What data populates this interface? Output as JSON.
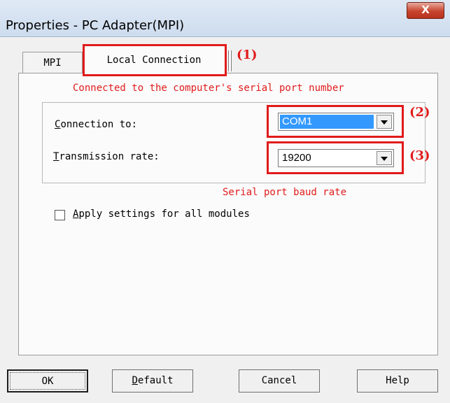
{
  "window": {
    "title": "Properties - PC Adapter(MPI)",
    "close_glyph": "X"
  },
  "tabs": [
    {
      "label": "MPI",
      "active": false
    },
    {
      "label": "Local Connection",
      "active": true
    }
  ],
  "annotations": {
    "tab_marker": "(1)",
    "port_marker": "(2)",
    "rate_marker": "(3)",
    "port_note": "Connected to the computer's serial port number",
    "rate_note": "Serial port baud rate",
    "highlight_color": "#e11b1b"
  },
  "connection": {
    "connection_to_label_key": "C",
    "connection_to_label_rest": "onnection to:",
    "connection_to_value": "COM1",
    "transmission_rate_label_key": "T",
    "transmission_rate_label_rest": "ransmission rate:",
    "transmission_rate_value": "19200"
  },
  "apply_all": {
    "label_key": "A",
    "label_rest": "pply settings for all modules",
    "checked": false
  },
  "buttons": {
    "ok": "OK",
    "default_key": "D",
    "default_rest": "efault",
    "cancel": "Cancel",
    "help": "Help"
  }
}
